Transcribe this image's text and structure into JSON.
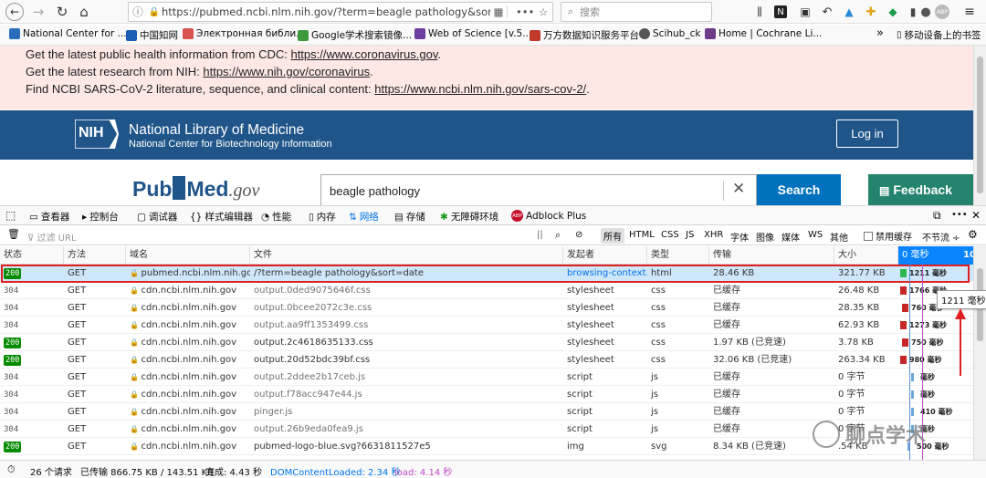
{
  "browser": {
    "url": "https://pubmed.ncbi.nlm.nih.gov/?term=beagle pathology&sort=",
    "search_placeholder": "搜索"
  },
  "bookmarks": [
    {
      "label": "National Center for ...",
      "color": "#2a6ebb"
    },
    {
      "label": "中国知网",
      "color": "#1a5fb4"
    },
    {
      "label": "Электронная библи...",
      "color": "#d9534f"
    },
    {
      "label": "Google学术搜索镜像...",
      "color": "#3c9a3c"
    },
    {
      "label": "Web of Science [v.5....",
      "color": "#6b3fa0"
    },
    {
      "label": "万方数据知识服务平台",
      "color": "#c0392b"
    },
    {
      "label": "Scihub_ck",
      "color": "#555555"
    },
    {
      "label": "Home | Cochrane Li...",
      "color": "#6e3b8a"
    }
  ],
  "bookmarks_overflow": "»",
  "bookmarks_mobile": "移动设备上的书签",
  "alert": {
    "line1_text": "Get the latest public health information from CDC: ",
    "line1_link": "https://www.coronavirus.gov",
    "line2_text": "Get the latest research from NIH: ",
    "line2_link": "https://www.nih.gov/coronavirus",
    "line3_text": "Find NCBI SARS-CoV-2 literature, sequence, and clinical content: ",
    "line3_link": "https://www.ncbi.nlm.nih.gov/sars-cov-2/"
  },
  "nlm": {
    "logo": "NIH",
    "title": "National Library of Medicine",
    "subtitle": "National Center for Biotechnology Information",
    "login": "Log in"
  },
  "pubmed": {
    "logo_pub": "Pub",
    "logo_med": "Med",
    "logo_gov": ".gov",
    "search_value": "beagle pathology",
    "search_button": "Search",
    "feedback": "Feedback"
  },
  "devtools": {
    "tabs": [
      "查看器",
      "控制台",
      "调试器",
      "样式编辑器",
      "性能",
      "内存",
      "网络",
      "存储",
      "无障碍环境",
      "Adblock Plus"
    ],
    "filter_placeholder": "过滤 URL",
    "filter_types": [
      "所有",
      "HTML",
      "CSS",
      "JS",
      "XHR",
      "字体",
      "图像",
      "媒体",
      "WS",
      "其他"
    ],
    "disable_cache": "禁用缓存",
    "throttle": "不节流 ÷",
    "columns": [
      "状态",
      "方法",
      "域名",
      "文件",
      "发起者",
      "类型",
      "传输",
      "大小"
    ],
    "timeline_start": "0 毫秒",
    "timeline_end": "10",
    "tooltip": "1211 毫秒",
    "rows": [
      {
        "status": "200",
        "method": "GET",
        "domain": "pubmed.ncbi.nlm.nih.gov",
        "file": "/?term=beagle pathology&sort=date",
        "initiator": "browsing-context...",
        "type": "html",
        "transfer": "28.46 KB",
        "size": "321.77 KB",
        "time": "1211 毫秒"
      },
      {
        "status": "304",
        "method": "GET",
        "domain": "cdn.ncbi.nlm.nih.gov",
        "file": "output.0ded9075646f.css",
        "initiator": "stylesheet",
        "type": "css",
        "transfer": "已缓存",
        "size": "26.48 KB",
        "time": "1766 毫秒"
      },
      {
        "status": "304",
        "method": "GET",
        "domain": "cdn.ncbi.nlm.nih.gov",
        "file": "output.0bcee2072c3e.css",
        "initiator": "stylesheet",
        "type": "css",
        "transfer": "已缓存",
        "size": "28.35 KB",
        "time": "760 毫秒"
      },
      {
        "status": "304",
        "method": "GET",
        "domain": "cdn.ncbi.nlm.nih.gov",
        "file": "output.aa9ff1353499.css",
        "initiator": "stylesheet",
        "type": "css",
        "transfer": "已缓存",
        "size": "62.93 KB",
        "time": "1273 毫秒"
      },
      {
        "status": "200",
        "method": "GET",
        "domain": "cdn.ncbi.nlm.nih.gov",
        "file": "output.2c4618635133.css",
        "initiator": "stylesheet",
        "type": "css",
        "transfer": "1.97 KB (已竞速)",
        "size": "3.78 KB",
        "time": "750 毫秒"
      },
      {
        "status": "200",
        "method": "GET",
        "domain": "cdn.ncbi.nlm.nih.gov",
        "file": "output.20d52bdc39bf.css",
        "initiator": "stylesheet",
        "type": "css",
        "transfer": "32.06 KB (已竞速)",
        "size": "263.34 KB",
        "time": "980 毫秒"
      },
      {
        "status": "304",
        "method": "GET",
        "domain": "cdn.ncbi.nlm.nih.gov",
        "file": "output.2ddee2b17ceb.js",
        "initiator": "script",
        "type": "js",
        "transfer": "已缓存",
        "size": "0 字节",
        "time": "毫秒"
      },
      {
        "status": "304",
        "method": "GET",
        "domain": "cdn.ncbi.nlm.nih.gov",
        "file": "output.f78acc947e44.js",
        "initiator": "script",
        "type": "js",
        "transfer": "已缓存",
        "size": "0 字节",
        "time": "毫秒"
      },
      {
        "status": "304",
        "method": "GET",
        "domain": "cdn.ncbi.nlm.nih.gov",
        "file": "pinger.js",
        "initiator": "script",
        "type": "js",
        "transfer": "已缓存",
        "size": "0 字节",
        "time": "410 毫秒"
      },
      {
        "status": "304",
        "method": "GET",
        "domain": "cdn.ncbi.nlm.nih.gov",
        "file": "output.26b9eda0fea9.js",
        "initiator": "script",
        "type": "js",
        "transfer": "已缓存",
        "size": "0 字节",
        "time": "毫秒"
      },
      {
        "status": "200",
        "method": "GET",
        "domain": "cdn.ncbi.nlm.nih.gov",
        "file": "pubmed-logo-blue.svg?6631811527e5",
        "initiator": "img",
        "type": "svg",
        "transfer": "8.34 KB (已竞速)",
        "size": ".54 KB",
        "time": "500 毫秒"
      }
    ],
    "footer": {
      "requests": "26 个请求",
      "transferred": "已传输 866.75 KB / 143.51 KB",
      "finish": "完成: 4.43 秒",
      "domcontent": "DOMContentLoaded: 2.34 秒",
      "load": "load: 4.14 秒"
    }
  },
  "watermark": "聊点学术"
}
